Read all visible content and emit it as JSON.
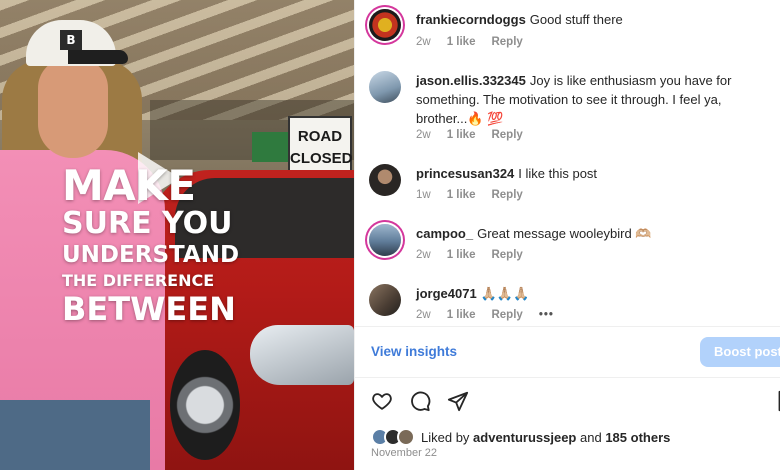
{
  "video": {
    "overlay_lines": [
      "MAKE",
      "SURE YOU",
      "UNDERSTAND",
      "THE DIFFERENCE",
      "BETWEEN"
    ],
    "sign_lines": [
      "ROAD",
      "CLOSED"
    ],
    "cap_logo": "B"
  },
  "comments": [
    {
      "username": "frankiecorndoggs",
      "text": "Good stuff there",
      "age": "2w",
      "likes": "1 like",
      "reply": "Reply",
      "avatar_color": "#1b1b1b",
      "ring": true
    },
    {
      "username": "jason.ellis.332345",
      "text": "Joy is like enthusiasm you have for something. The motivation to see it through. I feel ya, brother...🔥 💯",
      "age": "2w",
      "likes": "1 like",
      "reply": "Reply",
      "avatar_color": "#8aa6bf",
      "ring": false
    },
    {
      "username": "princesusan324",
      "text": "I like this post",
      "age": "1w",
      "likes": "1 like",
      "reply": "Reply",
      "avatar_color": "#3a3633",
      "ring": false
    },
    {
      "username": "campoo_",
      "text": "Great message wooleybird 🫶🏼",
      "age": "2w",
      "likes": "1 like",
      "reply": "Reply",
      "avatar_color": "#6e8fb2",
      "ring": true
    },
    {
      "username": "jorge4071",
      "text": "🙏🏼🙏🏼🙏🏼",
      "age": "2w",
      "likes": "1 like",
      "reply": "Reply",
      "avatar_color": "#5a4b3f",
      "ring": false
    }
  ],
  "more_dots": "•••",
  "insights_label": "View insights",
  "boost_label": "Boost post",
  "liked_by": {
    "prefix": "Liked by",
    "user": "adventurussjeep",
    "middle": "and",
    "others": "185 others"
  },
  "date": "November 22",
  "colors": {
    "link_blue": "#3f7bd9",
    "boost_bg": "#b2d2fb",
    "story_ring": "#d4379c",
    "meta_gray": "#8e8e8e"
  },
  "icons": [
    "heart-icon",
    "comment-icon",
    "share-icon",
    "bookmark-icon",
    "play-icon"
  ]
}
